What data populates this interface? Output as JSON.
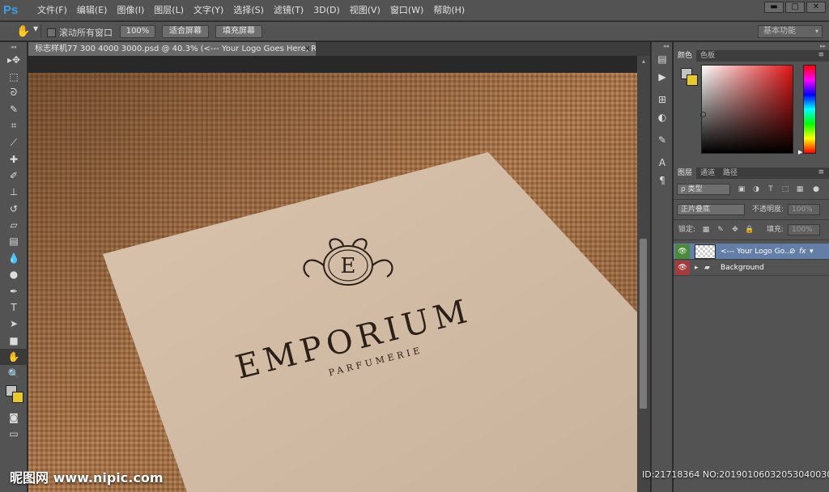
{
  "app": {
    "logo": "Ps"
  },
  "menu": [
    "文件(F)",
    "编辑(E)",
    "图像(I)",
    "图层(L)",
    "文字(Y)",
    "选择(S)",
    "滤镜(T)",
    "3D(D)",
    "视图(V)",
    "窗口(W)",
    "帮助(H)"
  ],
  "window_controls": {
    "minimize": "▬",
    "maximize": "□",
    "close": "✕"
  },
  "options": {
    "scroll_all_label": "滚动所有窗口",
    "btn_100": "100%",
    "btn_fit": "适合屏幕",
    "btn_fill": "填充屏幕",
    "workspace": "基本功能"
  },
  "document": {
    "tab_title": "标志样机77 300 4000 3000.psd @ 40.3% (<--- Your Logo Goes Here, RGB/8) *",
    "tab_close": "×",
    "logo_letter": "E",
    "brand": "EMPORIUM",
    "subbrand": "PARFUMERIE"
  },
  "colors": {
    "foreground": "#c2c2c2",
    "background": "#e8c92c",
    "accent_selected": "#637ea7"
  },
  "color_panel": {
    "tabs": [
      "颜色",
      "色板"
    ]
  },
  "layers_panel": {
    "tabs": [
      "图层",
      "通道",
      "路径"
    ],
    "filter_kind": "ρ 类型",
    "blend_mode": "正片叠底",
    "opacity_label": "不透明度:",
    "opacity_value": "100%",
    "lock_label": "锁定:",
    "fill_label": "填充:",
    "fill_value": "100%",
    "layers": [
      {
        "name": "<--- Your Logo Go...",
        "selected": true,
        "fx": "fx"
      },
      {
        "name": "Background",
        "selected": false
      }
    ]
  },
  "watermark": {
    "left": "昵图网 www.nipic.com",
    "right": "ID:21718364 NO:20190106032053040030"
  }
}
